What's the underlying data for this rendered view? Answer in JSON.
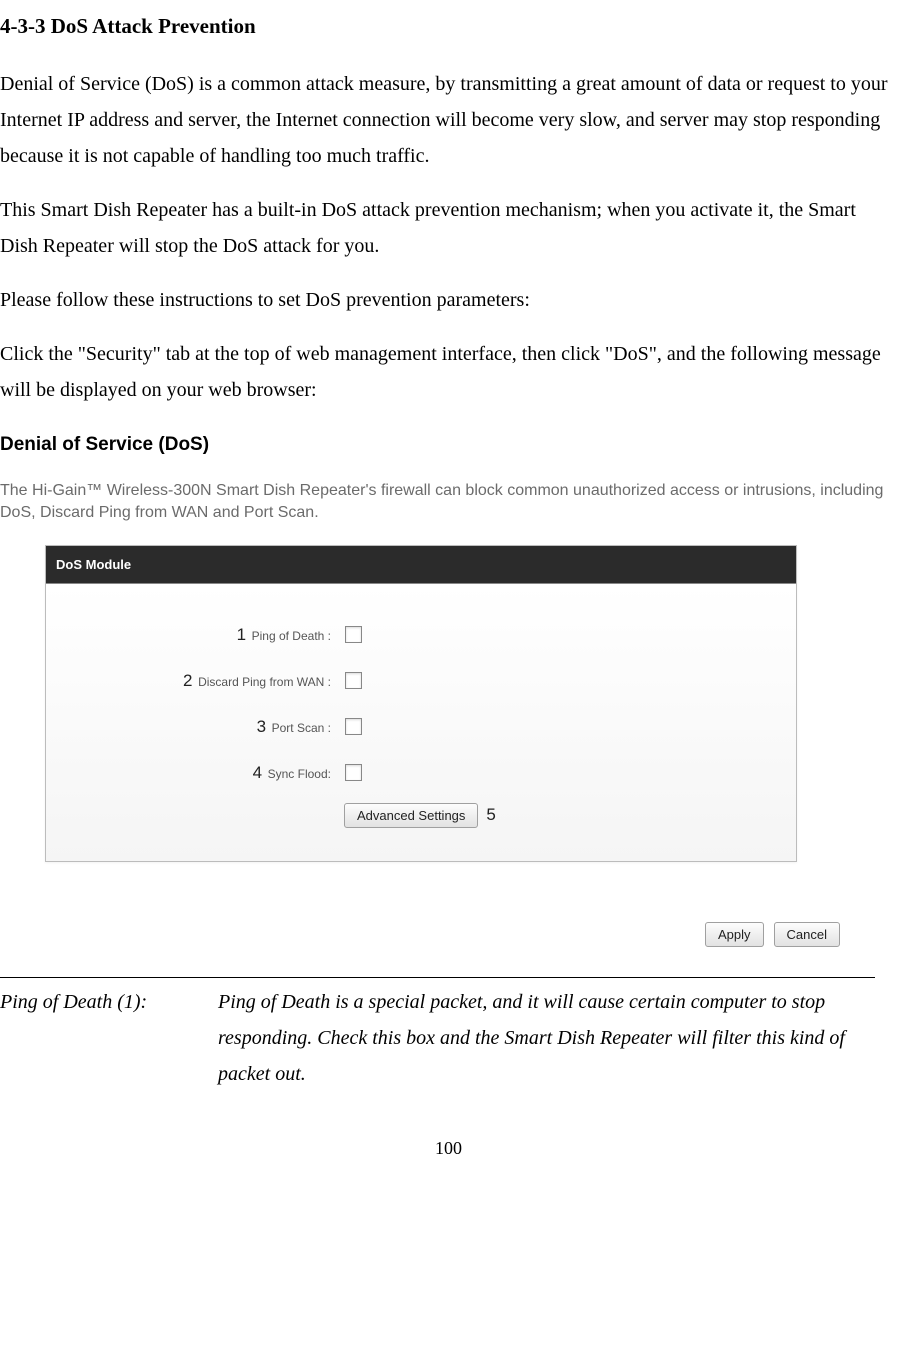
{
  "heading": "4-3-3 DoS Attack Prevention",
  "para1": "Denial of Service (DoS) is a common attack measure, by transmitting a great amount of data or request to your Internet IP address and server, the Internet connection will become very slow, and server may stop responding because it is not capable of handling too much traffic.",
  "para2": "This Smart Dish Repeater has a built-in DoS attack prevention mechanism; when you activate it, the Smart Dish Repeater will stop the DoS attack for you.",
  "para3": "Please follow these instructions to set DoS prevention parameters:",
  "para4": "Click the \"Security\" tab at the top of web management interface, then click \"DoS\", and the following message will be displayed on your web browser:",
  "screenshot": {
    "title": "Denial of Service (DoS)",
    "desc": "The Hi-Gain™ Wireless-300N Smart Dish Repeater's firewall can block common unauthorized access or intrusions, including DoS, Discard Ping from WAN and Port Scan.",
    "module_header": "DoS Module",
    "rows": [
      {
        "num": "1",
        "label": "Ping of Death :"
      },
      {
        "num": "2",
        "label": "Discard Ping from WAN :"
      },
      {
        "num": "3",
        "label": "Port Scan :"
      },
      {
        "num": "4",
        "label": "Sync Flood:"
      }
    ],
    "adv_button": "Advanced Settings",
    "adv_num": "5",
    "apply": "Apply",
    "cancel": "Cancel"
  },
  "param": {
    "name": "Ping of Death (1):",
    "desc": "Ping of Death is a special packet, and it will cause certain computer to stop responding. Check this box and the Smart Dish Repeater will filter this kind of packet out."
  },
  "page_number": "100"
}
